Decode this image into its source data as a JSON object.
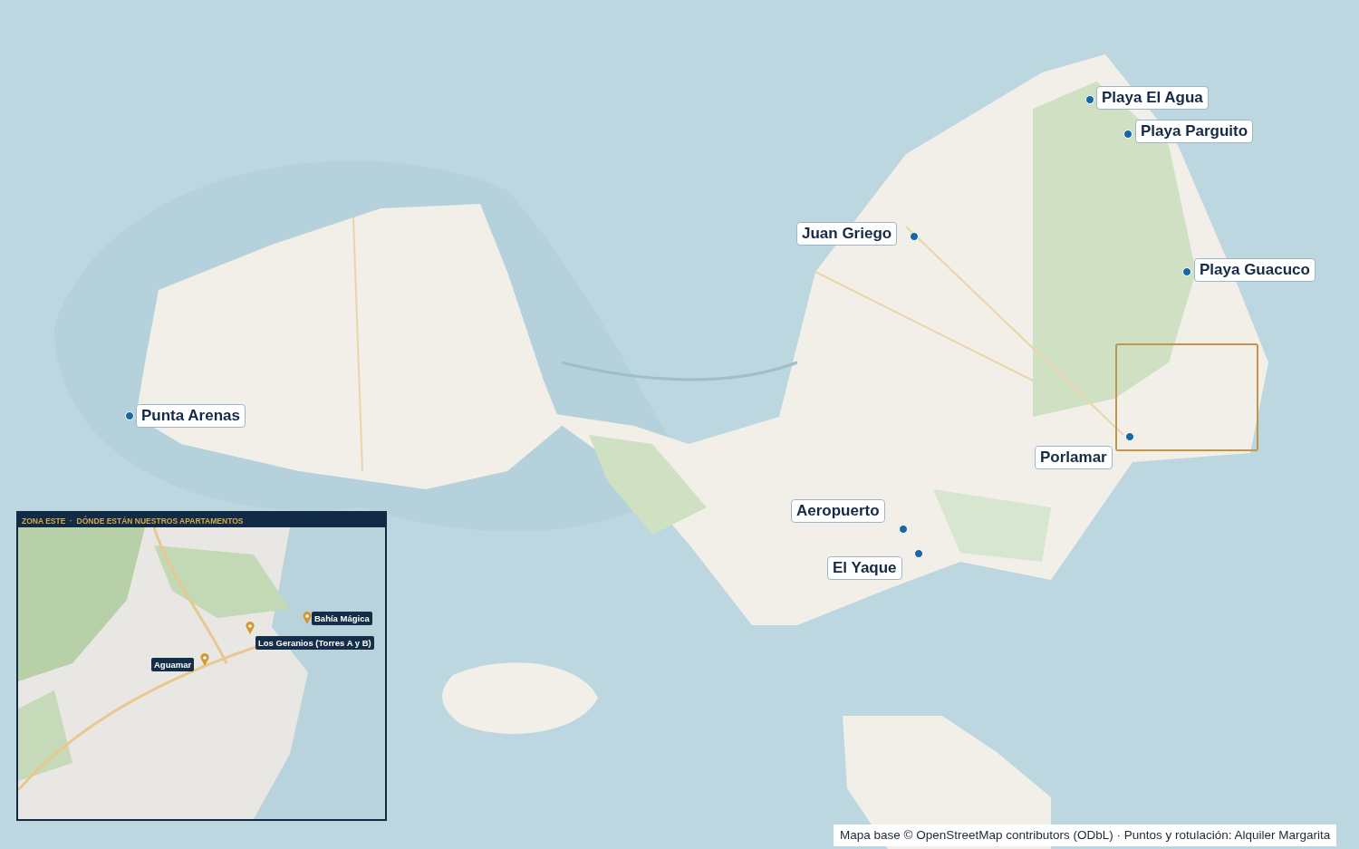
{
  "markers": [
    {
      "label": "Playa El Agua"
    },
    {
      "label": "Playa Parguito"
    },
    {
      "label": "Juan Griego"
    },
    {
      "label": "Playa Guacuco"
    },
    {
      "label": "Punta Arenas"
    },
    {
      "label": "Porlamar"
    },
    {
      "label": "Aeropuerto"
    },
    {
      "label": "El Yaque"
    }
  ],
  "inset": {
    "title": "ZONA ESTE  ·  DÓNDE ESTÁN NUESTROS APARTAMENTOS",
    "pins": [
      {
        "label": "Bahía Mágica"
      },
      {
        "label": "Los Geranios (Torres A y B)"
      },
      {
        "label": "Aguamar"
      }
    ]
  },
  "attribution": "Mapa base © OpenStreetMap contributors (ODbL) · Puntos y rotulación: Alquiler Margarita"
}
